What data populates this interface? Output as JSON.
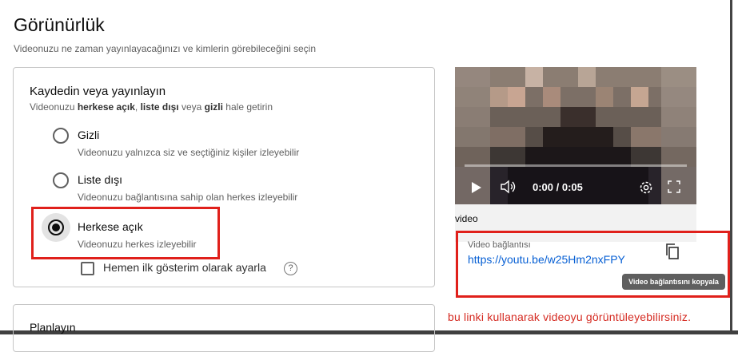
{
  "header": {
    "title": "Görünürlük",
    "subtitle": "Videonuzu ne zaman yayınlayacağınızı ve kimlerin görebileceğini seçin"
  },
  "publish": {
    "heading": "Kaydedin veya yayınlayın",
    "desc_prefix": "Videonuzu ",
    "desc_public": "herkese açık",
    "desc_sep1": ", ",
    "desc_unlisted": "liste dışı",
    "desc_mid": " veya ",
    "desc_private": "gizli",
    "desc_suffix": " hale getirin",
    "options": [
      {
        "label": "Gizli",
        "description": "Videonuzu yalnızca siz ve seçtiğiniz kişiler izleyebilir",
        "selected": false
      },
      {
        "label": "Liste dışı",
        "description": "Videonuzu bağlantısına sahip olan herkes izleyebilir",
        "selected": false
      },
      {
        "label": "Herkese açık",
        "description": "Videonuzu herkes izleyebilir",
        "selected": true
      }
    ],
    "premiere_label": "Hemen ilk gösterim olarak ayarla",
    "help_glyph": "?"
  },
  "schedule": {
    "heading": "Planlayın"
  },
  "preview": {
    "time": "0:00 / 0:05",
    "video_name": "video",
    "link_caption": "Video bağlantısı",
    "link": "https://youtu.be/w25Hm2nxFPY",
    "copy_tooltip": "Video bağlantısını kopyala"
  },
  "annotation_text": "bu linki kullanarak videoyu görüntüleyebilirsiniz.",
  "colors": {
    "highlight": "#e0201b",
    "link": "#065fd4",
    "annotation": "#d52a21"
  }
}
